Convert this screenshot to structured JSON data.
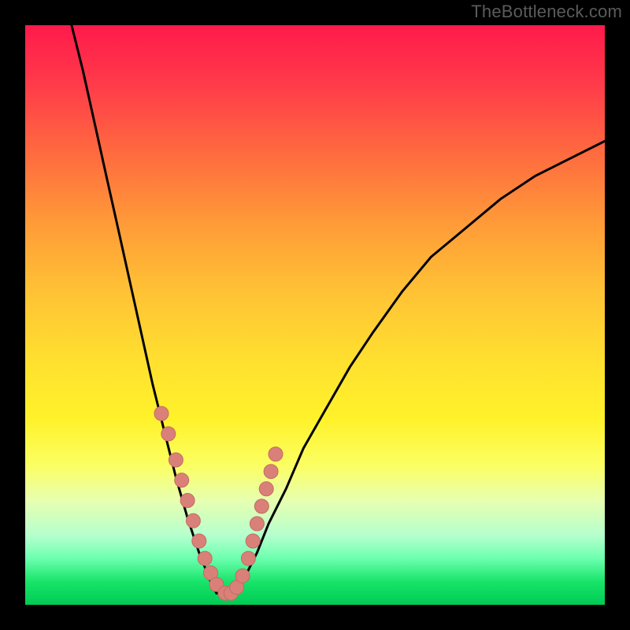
{
  "watermark": "TheBottleneck.com",
  "chart_data": {
    "type": "line",
    "title": "",
    "xlabel": "",
    "ylabel": "",
    "xlim": [
      0,
      100
    ],
    "ylim": [
      0,
      100
    ],
    "series": [
      {
        "name": "left-curve",
        "x": [
          8,
          10,
          12,
          14,
          16,
          18,
          20,
          22,
          24,
          26,
          28,
          30,
          32,
          33
        ],
        "y": [
          100,
          92,
          83,
          74,
          65,
          56,
          47,
          38,
          30,
          22,
          15,
          9,
          4,
          2
        ]
      },
      {
        "name": "right-curve",
        "x": [
          36,
          38,
          40,
          42,
          45,
          48,
          52,
          56,
          60,
          65,
          70,
          76,
          82,
          88,
          94,
          100
        ],
        "y": [
          2,
          5,
          9,
          14,
          20,
          27,
          34,
          41,
          47,
          54,
          60,
          65,
          70,
          74,
          77,
          80
        ]
      }
    ],
    "floor": {
      "name": "floor",
      "x": [
        33,
        36
      ],
      "y": [
        2,
        2
      ]
    },
    "markers": {
      "name": "sample-points",
      "x": [
        23.5,
        24.7,
        26.0,
        27.0,
        28.0,
        29.0,
        30.0,
        31.0,
        32.0,
        33.0,
        34.5,
        35.5,
        36.5,
        37.5,
        38.5,
        39.3,
        40.0,
        40.8,
        41.6,
        42.4,
        43.2
      ],
      "y": [
        33.0,
        29.5,
        25.0,
        21.5,
        18.0,
        14.5,
        11.0,
        8.0,
        5.5,
        3.5,
        2.0,
        2.0,
        3.0,
        5.0,
        8.0,
        11.0,
        14.0,
        17.0,
        20.0,
        23.0,
        26.0
      ]
    },
    "gradient_colors": {
      "top": "#ff1a4b",
      "mid": "#ffe02f",
      "bottom": "#00cc55"
    }
  }
}
